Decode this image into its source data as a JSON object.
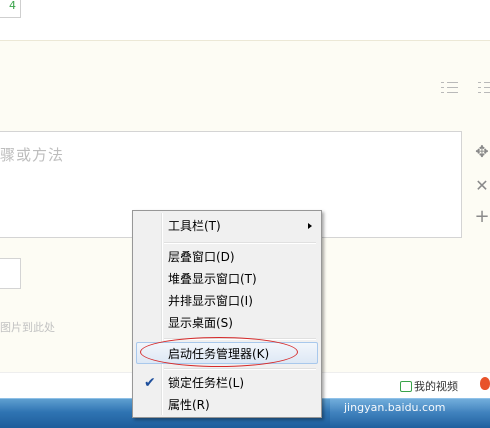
{
  "editor": {
    "top_button_label": "4",
    "step_placeholder": "骤或方法",
    "upload_hint": "图片到此处",
    "my_video_label": "我的视频"
  },
  "context_menu": {
    "items": [
      {
        "label": "工具栏(T)",
        "has_submenu": true
      },
      {
        "label": "层叠窗口(D)"
      },
      {
        "label": "堆叠显示窗口(T)"
      },
      {
        "label": "并排显示窗口(I)"
      },
      {
        "label": "显示桌面(S)"
      },
      {
        "label": "启动任务管理器(K)",
        "highlighted": true,
        "annotated": true
      },
      {
        "label": "锁定任务栏(L)",
        "checked": true
      },
      {
        "label": "属性(R)"
      }
    ]
  },
  "taskbar": {
    "watermark": "jingyan.baidu.com"
  },
  "colors": {
    "cream_background": "#fdfcf4",
    "taskbar_blue": "#2f74b3",
    "annotation_red": "#d62b2b",
    "menu_background": "#f0f0f0"
  }
}
